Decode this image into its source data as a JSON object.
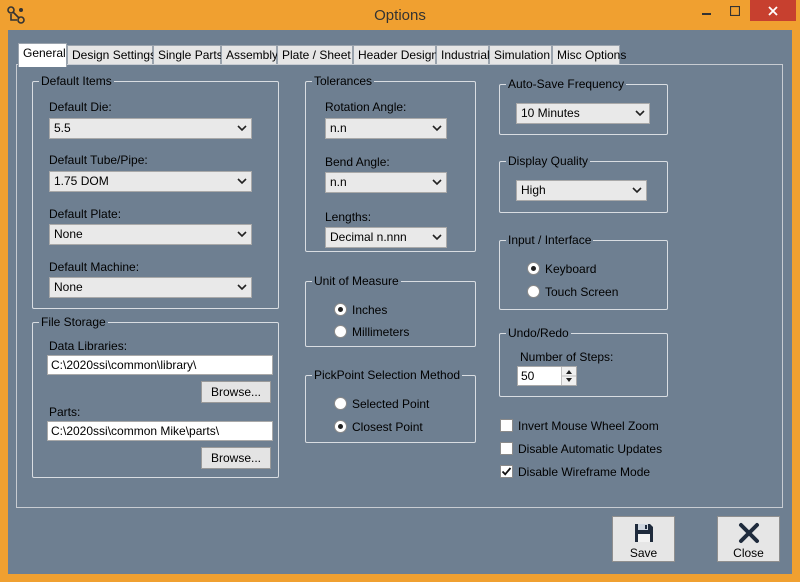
{
  "window": {
    "title": "Options"
  },
  "tabs": [
    {
      "label": "General",
      "active": true
    },
    {
      "label": "Design Settings"
    },
    {
      "label": "Single Parts"
    },
    {
      "label": "Assembly"
    },
    {
      "label": "Plate / Sheet"
    },
    {
      "label": "Header Design"
    },
    {
      "label": "Industrial"
    },
    {
      "label": "Simulation"
    },
    {
      "label": "Misc Options"
    }
  ],
  "default_items": {
    "title": "Default Items",
    "die_label": "Default Die:",
    "die_value": "5.5",
    "tube_label": "Default Tube/Pipe:",
    "tube_value": "1.75 DOM",
    "plate_label": "Default Plate:",
    "plate_value": "None",
    "machine_label": "Default Machine:",
    "machine_value": "None"
  },
  "file_storage": {
    "title": "File Storage",
    "libraries_label": "Data Libraries:",
    "libraries_value": "C:\\2020ssi\\common\\library\\",
    "browse_label": "Browse...",
    "parts_label": "Parts:",
    "parts_value": "C:\\2020ssi\\common Mike\\parts\\"
  },
  "tolerances": {
    "title": "Tolerances",
    "rotation_label": "Rotation Angle:",
    "rotation_value": "n.n",
    "bend_label": "Bend Angle:",
    "bend_value": "n.n",
    "lengths_label": "Lengths:",
    "lengths_value": "Decimal n.nnn"
  },
  "unit_of_measure": {
    "title": "Unit of Measure",
    "options": [
      {
        "label": "Inches",
        "selected": true
      },
      {
        "label": "Millimeters",
        "selected": false
      }
    ]
  },
  "pickpoint": {
    "title": "PickPoint Selection Method",
    "options": [
      {
        "label": "Selected Point",
        "selected": false
      },
      {
        "label": "Closest Point",
        "selected": true
      }
    ]
  },
  "autosave": {
    "title": "Auto-Save Frequency",
    "value": "10 Minutes"
  },
  "display_quality": {
    "title": "Display Quality",
    "value": "High"
  },
  "input_interface": {
    "title": "Input / Interface",
    "options": [
      {
        "label": "Keyboard",
        "selected": true
      },
      {
        "label": "Touch Screen",
        "selected": false
      }
    ]
  },
  "undo_redo": {
    "title": "Undo/Redo",
    "steps_label": "Number of Steps:",
    "steps_value": "50"
  },
  "checkboxes": [
    {
      "label": "Invert Mouse Wheel Zoom",
      "checked": false
    },
    {
      "label": "Disable Automatic Updates",
      "checked": false
    },
    {
      "label": "Disable Wireframe Mode",
      "checked": true
    }
  ],
  "footer": {
    "save_label": "Save",
    "close_label": "Close"
  },
  "colors": {
    "panel": "#6e7f91",
    "frame": "#f0a030",
    "close_button": "#c7402f"
  },
  "icons": {
    "app": "app-icon",
    "save": "floppy-disk-icon",
    "close": "x-close-icon"
  }
}
